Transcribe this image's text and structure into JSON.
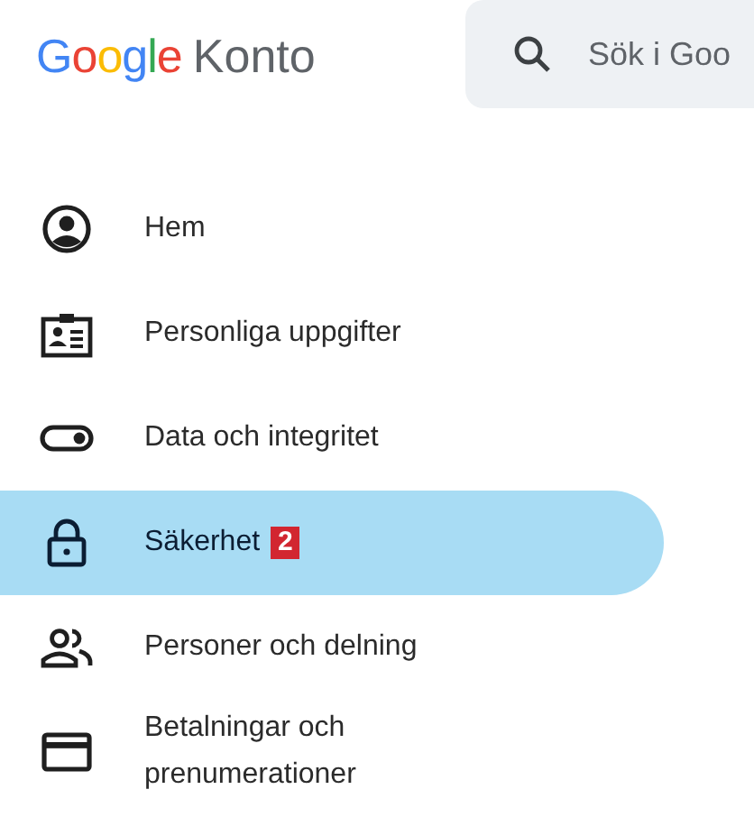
{
  "header": {
    "logo": "Google",
    "product": "Konto",
    "search": {
      "placeholder": "Sök i Goo"
    }
  },
  "sidebar": {
    "items": [
      {
        "kind": "home",
        "label": "Hem",
        "selected": false
      },
      {
        "kind": "personal",
        "label": "Personliga uppgifter",
        "selected": false
      },
      {
        "kind": "privacy",
        "label": "Data och integritet",
        "selected": false
      },
      {
        "kind": "security",
        "label": "Säkerhet",
        "selected": true,
        "badge": "2"
      },
      {
        "kind": "people",
        "label": "Personer och delning",
        "selected": false
      },
      {
        "kind": "payments",
        "label": "Betalningar och prenumerationer",
        "selected": false
      }
    ]
  }
}
